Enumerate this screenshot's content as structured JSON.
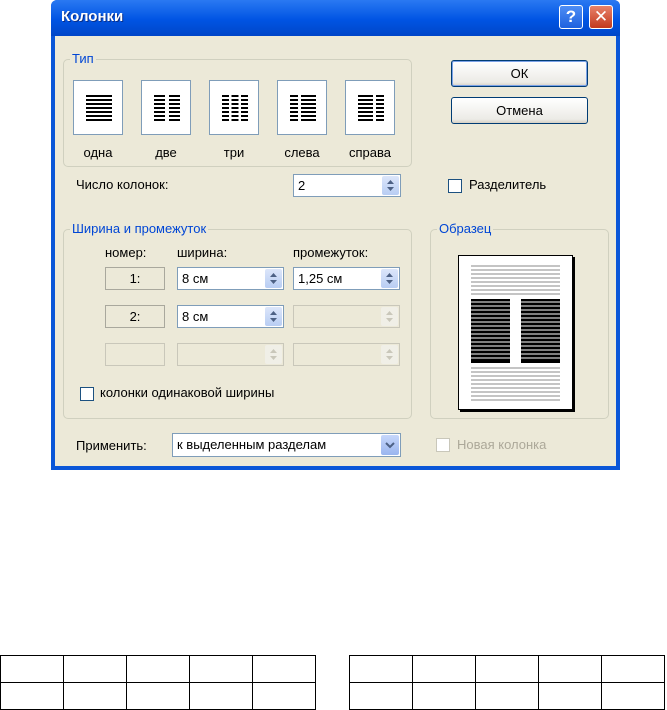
{
  "dialog": {
    "title": "Колонки",
    "help_glyph": "?",
    "close_glyph": "✕"
  },
  "type_group": {
    "label": "Тип",
    "presets": [
      {
        "label": "одна",
        "icon": "one-column-icon"
      },
      {
        "label": "две",
        "icon": "two-columns-icon"
      },
      {
        "label": "три",
        "icon": "three-columns-icon"
      },
      {
        "label": "слева",
        "icon": "left-column-icon"
      },
      {
        "label": "справа",
        "icon": "right-column-icon"
      }
    ]
  },
  "buttons": {
    "ok": "ОК",
    "cancel": "Отмена"
  },
  "column_count": {
    "label": "Число колонок:",
    "value": "2"
  },
  "separator": {
    "label": "Разделитель",
    "checked": false
  },
  "width_group": {
    "label": "Ширина и промежуток",
    "headers": {
      "number": "номер:",
      "width": "ширина:",
      "spacing": "промежуток:"
    },
    "rows": [
      {
        "number": "1:",
        "width": "8 см",
        "spacing": "1,25 см"
      },
      {
        "number": "2:",
        "width": "8 см",
        "spacing": ""
      },
      {
        "number": "",
        "width": "",
        "spacing": ""
      }
    ],
    "equal_width_label": "колонки одинаковой ширины",
    "equal_width_checked": false
  },
  "preview": {
    "label": "Образец"
  },
  "apply": {
    "label": "Применить:",
    "selected": "к выделенным разделам"
  },
  "new_column": {
    "label": "Новая колонка",
    "checked": false
  },
  "colors": {
    "title_bar": "#0054e3",
    "dialog_bg": "#ece9d8",
    "group_label": "#0046d5"
  }
}
